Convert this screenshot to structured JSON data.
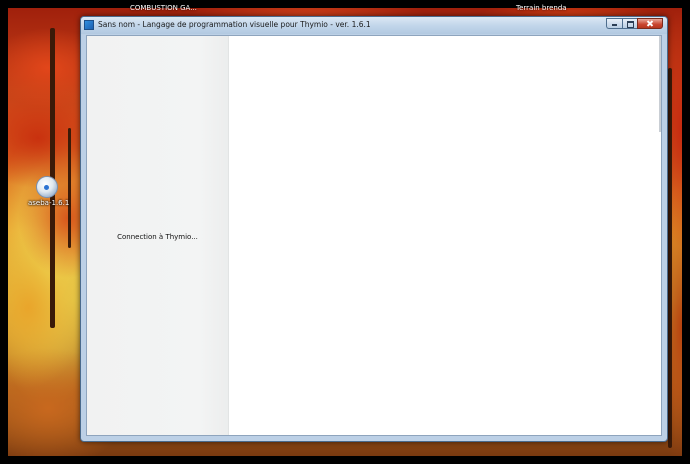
{
  "desktop": {
    "top_labels": [
      "COMBUSTION GA...",
      "Terrain brenda"
    ],
    "icon": {
      "label": "aseba-1.6.1",
      "icon_name": "installer-disc-icon"
    }
  },
  "window": {
    "title": "Sans nom - Langage de programmation visuelle pour Thymio - ver. 1.6.1",
    "app_icon": "thymio-app-icon",
    "buttons": {
      "minimize": "minimize-icon",
      "maximize": "maximize-icon",
      "close": "close-icon"
    },
    "left_panel": {
      "status_text": "Connection à Thymio..."
    }
  }
}
